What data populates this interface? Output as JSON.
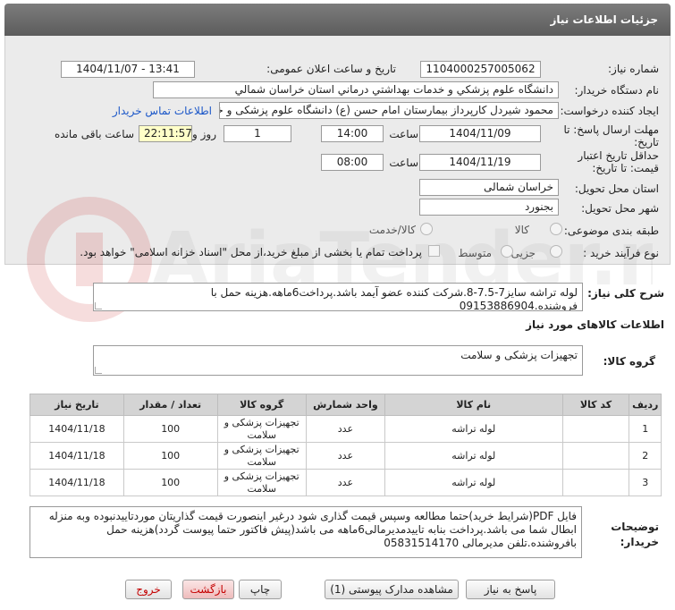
{
  "header": {
    "title": "جزئیات اطلاعات نیاز"
  },
  "fields": {
    "need_number_label": "شماره نیاز:",
    "need_number": "1104000257005062",
    "announce_label": "تاریخ و ساعت اعلان عمومی:",
    "announce_value": "1404/11/07 - 13:41",
    "buyer_org_label": "نام دستگاه خریدار:",
    "buyer_org": "دانشگاه علوم پزشکي و خدمات بهداشتي درماني استان خراسان شمالي",
    "requester_label": "ایجاد کننده درخواست:",
    "requester": "محمود شیردل کارپرداز بیمارستان امام حسن (ع) دانشگاه علوم پزشکی و خدمات",
    "contact_link": "اطلاعات تماس خریدار",
    "reply_deadline_label_1": "مهلت ارسال پاسخ: تا",
    "reply_deadline_label_2": "تاریخ:",
    "reply_date": "1404/11/09",
    "time_label": "ساعت",
    "reply_time": "14:00",
    "days_value": "1",
    "days_label": "روز و",
    "remaining_time": "22:11:57",
    "remaining_label": "ساعت باقی مانده",
    "validity_label_1": "حداقل تاریخ اعتبار",
    "validity_label_2": "قیمت: تا تاریخ:",
    "validity_date": "1404/11/19",
    "validity_time_label": "ساعت",
    "validity_time": "08:00",
    "province_label": "استان محل تحویل:",
    "province": "خراسان شمالی",
    "city_label": "شهر محل تحویل:",
    "city": "بجنورد",
    "category_label": "طبقه بندی موضوعی:",
    "category_goods": "کالا",
    "category_goods_service": "کالا/خدمت",
    "process_label": "نوع فرآیند خرید :",
    "process_partial": "جزیی",
    "process_medium": "متوسط",
    "payment_note": "پرداخت تمام یا بخشی از مبلغ خرید،از محل \"اسناد خزانه اسلامی\" خواهد بود."
  },
  "summary": {
    "label": "شرح کلی نیاز:",
    "text": "لوله تراشه سایز7-7.5-8.شرکت کننده عضو آیمد باشد.پرداخت6ماهه.هزینه حمل با فروشنده.09153886904"
  },
  "goods_section": {
    "title": "اطلاعات کالاهای مورد نیاز",
    "group_label": "گروه کالا:",
    "group_value": "تجهیزات پزشکی و سلامت"
  },
  "table": {
    "headers": [
      "ردیف",
      "کد کالا",
      "نام کالا",
      "واحد شمارش",
      "گروه کالا",
      "تعداد / مقدار",
      "تاریخ نیاز"
    ],
    "rows": [
      [
        "1",
        "",
        "لوله تراشه",
        "عدد",
        "تجهیزات پزشکی و سلامت",
        "100",
        "1404/11/18"
      ],
      [
        "2",
        "",
        "لوله تراشه",
        "عدد",
        "تجهیزات پزشکی و سلامت",
        "100",
        "1404/11/18"
      ],
      [
        "3",
        "",
        "لوله تراشه",
        "عدد",
        "تجهیزات پزشکی و سلامت",
        "100",
        "1404/11/18"
      ]
    ]
  },
  "buyer_notes": {
    "label_1": "توضیحات",
    "label_2": "خریدار:",
    "text": "فایل PDF(شرایط خرید)حتما مطالعه وسپس قیمت گذاری شود درغیر اینصورت قیمت گذاریتان موردتاییدنبوده وبه منزله ابطال شما می باشد.پرداخت بنابه تاییدمدیرمالی6ماهه می باشد(پیش فاکتور حتما پیوست گردد)هزینه حمل بافروشنده.تلفن مدیرمالی 05831514170"
  },
  "buttons": {
    "reply": "پاسخ به نیاز",
    "view_docs": "مشاهده مدارک پیوستی (1)",
    "print": "چاپ",
    "back": "بازگشت",
    "exit": "خروج"
  },
  "watermark": {
    "text": "AriaTender.net"
  },
  "colors": {
    "titlebar": "#6b6b6b",
    "panel": "#ebebeb",
    "remaining_bg": "#ffffc8",
    "link": "#1a56c8",
    "exit_text": "#c40000"
  }
}
